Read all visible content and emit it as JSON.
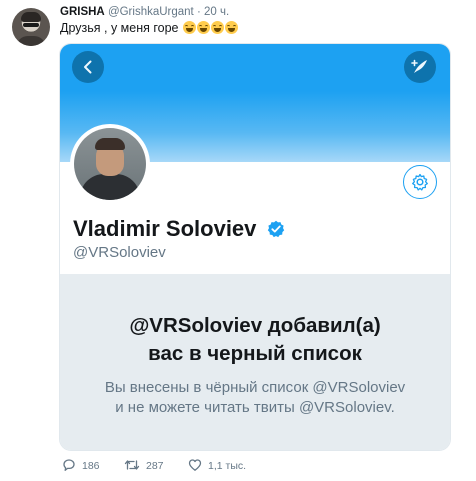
{
  "tweet": {
    "author_name": "GRISHA",
    "author_handle": "@GrishkaUrgant",
    "separator": "·",
    "time": "20 ч.",
    "text": "Друзья , у меня горе",
    "emoji_count": 4,
    "emoji_name": "face-with-tears-of-joy"
  },
  "card": {
    "display_name": "Vladimir Soloviev",
    "screen_name": "@VRSoloviev",
    "verified": true,
    "banner_color": "#1da1f2",
    "blocked_title_line1": "@VRSoloviev добавил(а)",
    "blocked_title_line2": "вас в черный список",
    "blocked_desc_line1": "Вы внесены в чёрный список @VRSoloviev",
    "blocked_desc_line2": "и не можете читать твиты @VRSoloviev."
  },
  "actions": {
    "replies": "186",
    "retweets": "287",
    "likes": "1,1 тыс."
  },
  "icons": {
    "back": "chevron-left-icon",
    "compose": "compose-tweet-icon",
    "settings": "gear-icon",
    "verified": "verified-badge-icon",
    "reply": "reply-icon",
    "retweet": "retweet-icon",
    "like": "heart-icon"
  },
  "colors": {
    "accent": "#1da1f2",
    "text": "#14171a",
    "muted": "#657786",
    "panel": "#e6ecf0"
  }
}
